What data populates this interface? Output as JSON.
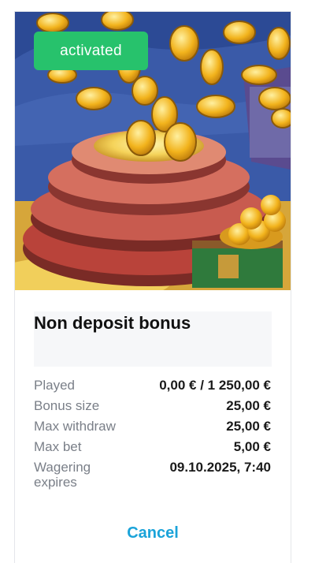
{
  "bonus_card": {
    "status_badge": "activated",
    "title": "Non deposit bonus",
    "details": [
      {
        "label": "Played",
        "value": "0,00 € / 1 250,00 €"
      },
      {
        "label": "Bonus size",
        "value": "25,00 €"
      },
      {
        "label": "Max withdraw",
        "value": "25,00 €"
      },
      {
        "label": "Max bet",
        "value": "5,00 €"
      },
      {
        "label": "Wagering expires",
        "value": "09.10.2025, 7:40"
      }
    ],
    "cancel_label": "Cancel"
  },
  "colors": {
    "badge": "#27c26c",
    "cancel_link": "#1aa3d9",
    "coin": "#f2b31c"
  }
}
